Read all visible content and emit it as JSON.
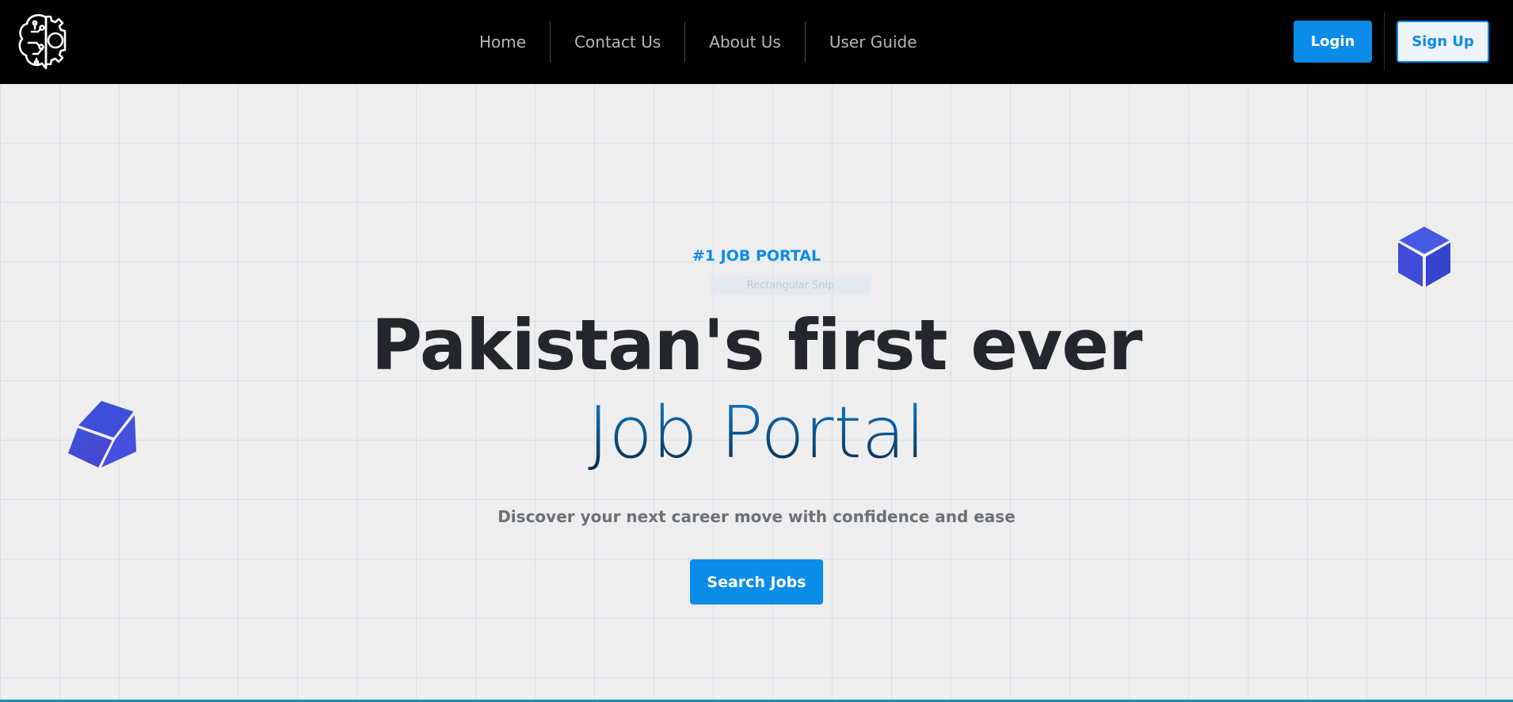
{
  "navbar": {
    "links": [
      {
        "label": "Home"
      },
      {
        "label": "Contact Us"
      },
      {
        "label": "About Us"
      },
      {
        "label": "User Guide"
      }
    ],
    "login_label": "Login",
    "signup_label": "Sign Up"
  },
  "hero": {
    "eyebrow": "#1 JOB PORTAL",
    "snip_tooltip": "Rectangular Snip",
    "headline": "Pakistan's first ever",
    "headline_accent": "Job Portal",
    "subtitle": "Discover your next career move with confidence and ease",
    "search_button_label": "Search Jobs"
  },
  "icons": {
    "logo": "brain-gear-icon",
    "decor_left": "cube-icon",
    "decor_right": "cube-icon"
  },
  "colors": {
    "accent": "#0b8ce9",
    "navbar_bg": "#000000",
    "hero_bg": "#eeeeee",
    "headline": "#23262a",
    "cube": "#3f4fd8"
  }
}
